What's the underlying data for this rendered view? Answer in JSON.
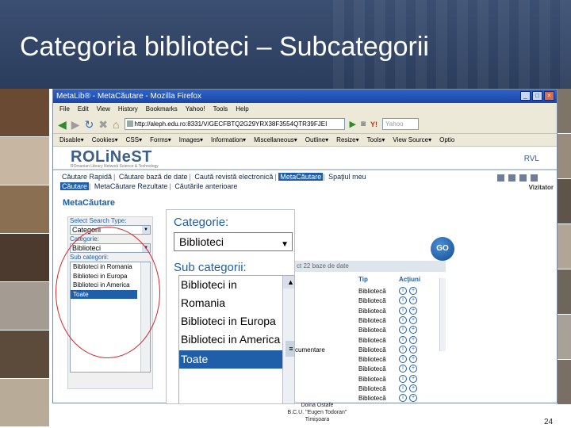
{
  "slide": {
    "title": "Categoria biblioteci – Subcategorii",
    "footer_line1": "Doina Ostafe",
    "footer_line2": "B.C.U. \"Eugen Todoran\"",
    "footer_line3": "Timişoara",
    "page_number": "24"
  },
  "browser": {
    "window_title": "MetaLib® - MetaCăutare - Mozilla Firefox",
    "menu": [
      "File",
      "Edit",
      "View",
      "History",
      "Bookmarks",
      "Yahoo!",
      "Tools",
      "Help"
    ],
    "url": "http://aleph.edu.ro:8331/V/GECFBTQ2G29YRX38F3554QTR39FJEI",
    "search_placeholder": "Yahoo",
    "webdev_toolbar": [
      "Disable▾",
      "Cookies▾",
      "CSS▾",
      "Forms▾",
      "Images▾",
      "Information▾",
      "Miscellaneous▾",
      "Outline▾",
      "Resize▾",
      "Tools▾",
      "View Source▾",
      "Optio"
    ]
  },
  "site": {
    "logo": "ROLiNeST",
    "logo_sub": "ROmanian Library Network Science & Technology",
    "rvl": "RVL",
    "nav_links": [
      "Căutare Rapidă",
      "Căutare bază de date",
      "Caută revistă electronică",
      "MetaCăutare",
      "Spaţiul meu"
    ],
    "sub_links": [
      "Căutare",
      "MetaCăutare Rezultate",
      "Căutările anterioare"
    ],
    "visitor": "Vizitator",
    "page_heading": "MetaCăutare",
    "select_search_type_label": "Select Search Type:",
    "search_type_value": "Categorii",
    "category_label": "Categorie:",
    "category_value": "Biblioteci",
    "subcategory_label": "Sub categorii:",
    "subcategories": [
      "Biblioteci in Romania",
      "Biblioteci in Europa",
      "Biblioteci in America",
      "Toate"
    ],
    "go_label": "GO",
    "results_bar": "ct 22 baze de date",
    "col_tip": "Tip",
    "col_actions": "Acţiuni",
    "results_rows": [
      {
        "name": "",
        "tip": "Bibliotecă"
      },
      {
        "name": "",
        "tip": "Bibliotecă"
      },
      {
        "name": "",
        "tip": "Bibliotecă"
      },
      {
        "name": "",
        "tip": "Bibliotecă"
      },
      {
        "name": "",
        "tip": "Bibliotecă"
      },
      {
        "name": "",
        "tip": "Bibliotecă"
      },
      {
        "name": "cumentare",
        "tip": "Bibliotecă"
      },
      {
        "name": "",
        "tip": "Bibliotecă"
      },
      {
        "name": "",
        "tip": "Bibliotecă"
      },
      {
        "name": "",
        "tip": "Bibliotecă"
      },
      {
        "name": "",
        "tip": "Bibliotecă"
      },
      {
        "name": "",
        "tip": "Bibliotecă"
      }
    ]
  },
  "zoom": {
    "category_label": "Categorie:",
    "category_value": "Biblioteci",
    "subcategory_label": "Sub categorii:",
    "subcategories": [
      "Biblioteci in Romania",
      "Biblioteci in Europa",
      "Biblioteci in America",
      "Toate"
    ],
    "selected": "Toate"
  },
  "colors": {
    "header_bg": "#2b3d5c",
    "accent": "#1f5ea8",
    "highlight_ellipse": "#d7262a"
  }
}
